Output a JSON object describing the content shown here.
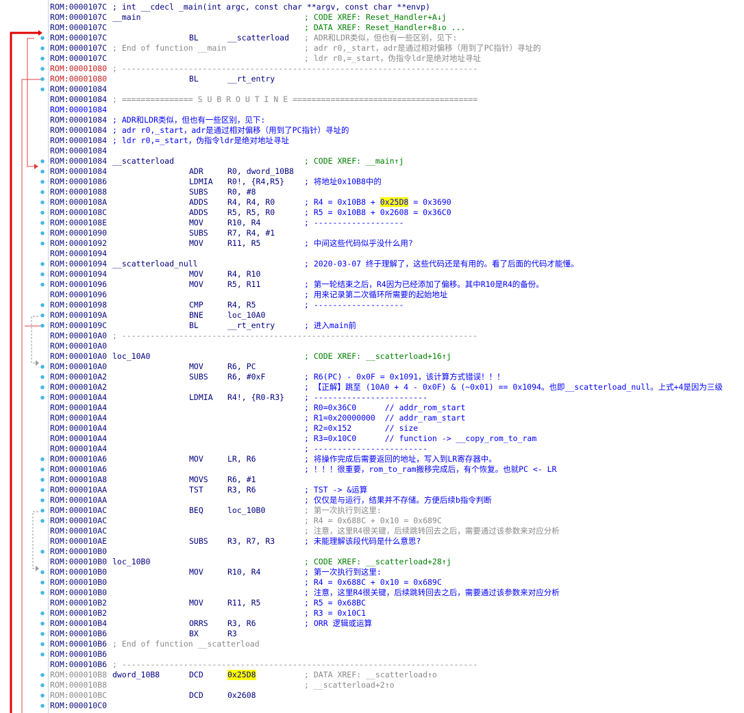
{
  "lines": [
    {
      "addr": "ROM:0000107C",
      "full": "; int __cdecl _main(int argc, const char **argv, const char **envp)",
      "fullColor": "navy"
    },
    {
      "addr": "ROM:0000107C",
      "label": "__main",
      "comment": "; CODE XREF: Reset_Handler+A↓j",
      "commentColor": "green"
    },
    {
      "addr": "ROM:0000107C",
      "comment": "; DATA XREF: Reset_Handler+8↓o ...",
      "commentColor": "green"
    },
    {
      "addr": "ROM:0000107C",
      "mnem": "BL",
      "ops": "__scatterload",
      "comment": "; ADR和LDR类似，但也有一些区别，见下:",
      "commentColor": "gray"
    },
    {
      "addr": "ROM:0000107C",
      "full": "; End of function __main",
      "fullColor": "gray",
      "comment": "; adr r0,_start，adr是通过相对偏移（用到了PC指针）寻址的",
      "commentColor": "gray"
    },
    {
      "addr": "ROM:0000107C",
      "comment": "; ldr r0,=_start，伪指令ldr是绝对地址寻址",
      "commentColor": "gray"
    },
    {
      "addr": "ROM:00001080",
      "addrColor": "red",
      "full": "; ---------------------------------------------------------------------------",
      "fullColor": "gray"
    },
    {
      "addr": "ROM:00001080",
      "addrColor": "red",
      "mnem": "BL",
      "ops": "__rt_entry"
    },
    {
      "addr": "ROM:00001084"
    },
    {
      "addr": "ROM:00001084",
      "full": "; =============== S U B R O U T I N E =======================================",
      "fullColor": "gray"
    },
    {
      "addr": "ROM:00001084",
      "addrColor": "blue"
    },
    {
      "addr": "ROM:00001084",
      "full": "; ADR和LDR类似，但也有一些区别，见下:",
      "fullColor": "blue"
    },
    {
      "addr": "ROM:00001084",
      "full": "; adr r0,_start，adr是通过相对偏移（用到了PC指针）寻址的",
      "fullColor": "blue"
    },
    {
      "addr": "ROM:00001084",
      "full": "; ldr r0,=_start，伪指令ldr是绝对地址寻址",
      "fullColor": "blue"
    },
    {
      "addr": "ROM:00001084"
    },
    {
      "addr": "ROM:00001084",
      "label": "__scatterload",
      "comment": "; CODE XREF: __main↑j",
      "commentColor": "green"
    },
    {
      "addr": "ROM:00001084",
      "mnem": "ADR",
      "ops": "R0, dword_10B8"
    },
    {
      "addr": "ROM:00001086",
      "mnem": "LDMIA",
      "ops": "R0!, {R4,R5}",
      "comment": "; 将地址0x10B8中的",
      "commentColor": "blue"
    },
    {
      "addr": "ROM:00001088",
      "mnem": "SUBS",
      "ops": "R0, #8"
    },
    {
      "addr": "ROM:0000108A",
      "mnem": "ADDS",
      "ops": "R4, R4, R0",
      "comment": "; R4 = 0x10B8 + ",
      "commentColor": "blue",
      "hl": "0x25D8",
      "comment2": " = 0x3690"
    },
    {
      "addr": "ROM:0000108C",
      "mnem": "ADDS",
      "ops": "R5, R5, R0",
      "comment": "; R5 = 0x10B8 + 0x2608 = 0x36C0",
      "commentColor": "blue"
    },
    {
      "addr": "ROM:0000108E",
      "mnem": "MOV",
      "ops": "R10, R4",
      "comment": "; -------------------",
      "commentColor": "blue"
    },
    {
      "addr": "ROM:00001090",
      "mnem": "SUBS",
      "ops": "R7, R4, #1"
    },
    {
      "addr": "ROM:00001092",
      "mnem": "MOV",
      "ops": "R11, R5",
      "comment": "; 中间这些代码似乎没什么用?",
      "commentColor": "blue"
    },
    {
      "addr": "ROM:00001094"
    },
    {
      "addr": "ROM:00001094",
      "label": "__scatterload_null",
      "comment": "; 2020-03-07 终于理解了，这些代码还是有用的。看了后面的代码才能懂。",
      "commentColor": "blue"
    },
    {
      "addr": "ROM:00001094",
      "mnem": "MOV",
      "ops": "R4, R10"
    },
    {
      "addr": "ROM:00001096",
      "mnem": "MOV",
      "ops": "R5, R11",
      "comment": "; 第一轮结束之后，R4因为已经添加了偏移。其中R10是R4的备份。",
      "commentColor": "blue"
    },
    {
      "addr": "ROM:00001096",
      "comment": "; 用来记录第二次循环所需要的起始地址",
      "commentColor": "blue"
    },
    {
      "addr": "ROM:00001098",
      "mnem": "CMP",
      "ops": "R4, R5",
      "comment": "; -------------------",
      "commentColor": "blue"
    },
    {
      "addr": "ROM:0000109A",
      "mnem": "BNE",
      "ops": "loc_10A0"
    },
    {
      "addr": "ROM:0000109C",
      "mnem": "BL",
      "ops": "__rt_entry",
      "comment": "; 进入main前",
      "commentColor": "blue"
    },
    {
      "addr": "ROM:000010A0",
      "full": "; ---------------------------------------------------------------------------",
      "fullColor": "gray"
    },
    {
      "addr": "ROM:000010A0"
    },
    {
      "addr": "ROM:000010A0",
      "label": "loc_10A0",
      "comment": "; CODE XREF: __scatterload+16↑j",
      "commentColor": "green"
    },
    {
      "addr": "ROM:000010A0",
      "mnem": "MOV",
      "ops": "R6, PC"
    },
    {
      "addr": "ROM:000010A2",
      "mnem": "SUBS",
      "ops": "R6, #0xF",
      "comment": "; R6(PC) - 0x0F = 0x1091，该计算方式错误！！！",
      "commentColor": "blue"
    },
    {
      "addr": "ROM:000010A2",
      "comment": "; 【正解】跳至 (10A0 + 4 - 0x0F) & (~0x01) == 0x1094。也即__scatterload_null。上式+4是因为三级",
      "commentColor": "blue"
    },
    {
      "addr": "ROM:000010A4",
      "mnem": "LDMIA",
      "ops": "R4!, {R0-R3}",
      "comment": "; ------------------------",
      "commentColor": "blue"
    },
    {
      "addr": "ROM:000010A4",
      "comment": "; R0=0x36C0      // addr_rom_start",
      "commentColor": "blue"
    },
    {
      "addr": "ROM:000010A4",
      "comment": "; R1=0x20000000  // addr_ram_start",
      "commentColor": "blue"
    },
    {
      "addr": "ROM:000010A4",
      "comment": "; R2=0x152       // size",
      "commentColor": "blue"
    },
    {
      "addr": "ROM:000010A4",
      "comment": "; R3=0x10C0      // function -> __copy_rom_to_ram",
      "commentColor": "blue"
    },
    {
      "addr": "ROM:000010A4",
      "comment": "; ------------------------",
      "commentColor": "blue"
    },
    {
      "addr": "ROM:000010A6",
      "mnem": "MOV",
      "ops": "LR, R6",
      "comment": "; 将操作完成后需要返回的地址，写入到LR寄存器中。",
      "commentColor": "blue"
    },
    {
      "addr": "ROM:000010A6",
      "comment": "; ！！！很重要，rom_to_ram搬移完成后，有个恢复。也就PC <- LR",
      "commentColor": "blue"
    },
    {
      "addr": "ROM:000010A8",
      "mnem": "MOVS",
      "ops": "R6, #1"
    },
    {
      "addr": "ROM:000010AA",
      "mnem": "TST",
      "ops": "R3, R6",
      "comment": "; TST -> &运算",
      "commentColor": "blue"
    },
    {
      "addr": "ROM:000010AA",
      "comment": "; 仅仅是与运行，结果并不存储。方便后续b指令判断",
      "commentColor": "blue"
    },
    {
      "addr": "ROM:000010AC",
      "mnem": "BEQ",
      "ops": "loc_10B0",
      "comment": "; 第一次执行到这里:",
      "commentColor": "gray"
    },
    {
      "addr": "ROM:000010AC",
      "comment": "; R4 = 0x688C + 0x10 = 0x689C",
      "commentColor": "gray"
    },
    {
      "addr": "ROM:000010AC",
      "comment": "; 注意，这里R4很关键，后续跳转回去之后，需要通过该参数来对应分析",
      "commentColor": "gray"
    },
    {
      "addr": "ROM:000010AE",
      "mnem": "SUBS",
      "ops": "R3, R7, R3",
      "comment": "; 未能理解该段代码是什么意思?",
      "commentColor": "blue"
    },
    {
      "addr": "ROM:000010B0"
    },
    {
      "addr": "ROM:000010B0",
      "label": "loc_10B0",
      "comment": "; CODE XREF: __scatterload+28↑j",
      "commentColor": "green"
    },
    {
      "addr": "ROM:000010B0",
      "mnem": "MOV",
      "ops": "R10, R4",
      "comment": "; 第一次执行到这里:",
      "commentColor": "blue"
    },
    {
      "addr": "ROM:000010B0",
      "comment": "; R4 = 0x688C + 0x10 = 0x689C",
      "commentColor": "blue"
    },
    {
      "addr": "ROM:000010B0",
      "comment": "; 注意，这里R4很关键，后续跳转回去之后，需要通过该参数来对应分析",
      "commentColor": "blue"
    },
    {
      "addr": "ROM:000010B2",
      "mnem": "MOV",
      "ops": "R11, R5",
      "comment": "; R5 = 0x68BC",
      "commentColor": "blue"
    },
    {
      "addr": "ROM:000010B2",
      "comment": "; R3 = 0x10C1",
      "commentColor": "blue"
    },
    {
      "addr": "ROM:000010B4",
      "mnem": "ORRS",
      "ops": "R3, R6",
      "comment": "; ORR 逻辑或运算",
      "commentColor": "blue"
    },
    {
      "addr": "ROM:000010B6",
      "mnem": "BX",
      "ops": "R3"
    },
    {
      "addr": "ROM:000010B6",
      "full": "; End of function __scatterload",
      "fullColor": "gray"
    },
    {
      "addr": "ROM:000010B6"
    },
    {
      "addr": "ROM:000010B6",
      "full": "; ---------------------------------------------------------------------------",
      "fullColor": "gray"
    },
    {
      "addr": "ROM:000010B8",
      "addrColor": "gray",
      "label": "dword_10B8",
      "mnem": "DCD",
      "hlOps": "0x25D8",
      "comment": "; DATA XREF: __scatterload↑o",
      "commentColor": "gray"
    },
    {
      "addr": "ROM:000010B8",
      "addrColor": "gray",
      "comment": "; __scatterload+2↑o",
      "commentColor": "gray"
    },
    {
      "addr": "ROM:000010BC",
      "addrColor": "gray",
      "mnem": "DCD",
      "ops": "0x2608"
    },
    {
      "addr": "ROM:000010C0"
    }
  ],
  "dotRows": [
    3,
    4,
    5,
    6,
    7,
    8,
    15,
    16,
    17,
    18,
    19,
    20,
    21,
    22,
    23,
    25,
    26,
    27,
    29,
    30,
    31,
    35,
    36,
    37,
    38,
    44,
    45,
    46,
    47,
    48,
    49,
    50,
    53,
    55,
    56,
    57,
    59,
    60,
    61,
    62,
    63,
    65,
    66,
    67,
    68
  ],
  "colors": {
    "accent": "#e00000",
    "dot": "#45b7e6",
    "addr": "#0a0a80",
    "comment": "#0000ff",
    "xref": "#008000",
    "muted": "#8a8a8a",
    "highlight": "#ffff00"
  }
}
